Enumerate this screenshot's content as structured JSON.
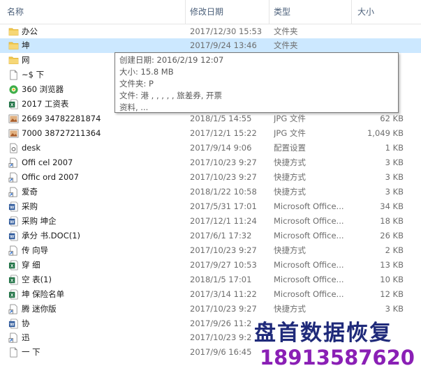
{
  "header": {
    "name_label": "名称",
    "date_label": "修改日期",
    "type_label": "类型",
    "size_label": "大小",
    "sort_arrow": "^"
  },
  "rows": [
    {
      "name": "办公",
      "date": "2017/12/30 15:53",
      "type": "文件夹",
      "size": "",
      "icon": "folder-icon"
    },
    {
      "name": "坤",
      "date": "2017/9/24 13:46",
      "type": "文件夹",
      "size": "",
      "icon": "folder-icon"
    },
    {
      "name": "网",
      "date": "",
      "type": "",
      "size": "",
      "icon": "folder-icon"
    },
    {
      "name": "~$   下",
      "date": "",
      "type": "",
      "size": "",
      "icon": "document-icon"
    },
    {
      "name": "360   浏览器",
      "date": "",
      "type": "",
      "size": "",
      "icon": "browser-icon"
    },
    {
      "name": "2017   工资表",
      "date": "",
      "type": "",
      "size": "",
      "icon": "excel-icon"
    },
    {
      "name": "2669   34782281874",
      "date": "2018/1/5 14:55",
      "type": "JPG 文件",
      "size": "62 KB",
      "icon": "image-icon"
    },
    {
      "name": "7000   38727211364",
      "date": "2017/12/1 15:22",
      "type": "JPG 文件",
      "size": "1,049 KB",
      "icon": "image-icon"
    },
    {
      "name": "desk",
      "date": "2017/9/14 9:06",
      "type": "配置设置",
      "size": "1 KB",
      "icon": "settings-file-icon"
    },
    {
      "name": "Offi   cel 2007",
      "date": "2017/10/23 9:27",
      "type": "快捷方式",
      "size": "3 KB",
      "icon": "shortcut-icon"
    },
    {
      "name": "Offic   ord 2007",
      "date": "2017/10/23 9:27",
      "type": "快捷方式",
      "size": "3 KB",
      "icon": "shortcut-icon"
    },
    {
      "name": "爱奇",
      "date": "2018/1/22 10:58",
      "type": "快捷方式",
      "size": "3 KB",
      "icon": "shortcut-icon"
    },
    {
      "name": "采购",
      "date": "2017/5/31 17:01",
      "type": "Microsoft Office...",
      "size": "34 KB",
      "icon": "word-icon"
    },
    {
      "name": "采购   坤企",
      "date": "2017/12/1 11:24",
      "type": "Microsoft Office...",
      "size": "18 KB",
      "icon": "word-icon"
    },
    {
      "name": "承分   书.DOC(1)",
      "date": "2017/6/1 17:32",
      "type": "Microsoft Office...",
      "size": "26 KB",
      "icon": "word-icon"
    },
    {
      "name": "传   向导",
      "date": "2017/10/23 9:27",
      "type": "快捷方式",
      "size": "2 KB",
      "icon": "shortcut-icon"
    },
    {
      "name": "穿   细",
      "date": "2017/9/27 10:53",
      "type": "Microsoft Office...",
      "size": "13 KB",
      "icon": "excel-icon"
    },
    {
      "name": "空   表(1)",
      "date": "2018/1/5 17:01",
      "type": "Microsoft Office...",
      "size": "10 KB",
      "icon": "excel-icon"
    },
    {
      "name": "坤   保险名单",
      "date": "2017/3/14 11:22",
      "type": "Microsoft Office...",
      "size": "12 KB",
      "icon": "excel-icon"
    },
    {
      "name": "腾   迷你版",
      "date": "2017/10/23 9:27",
      "type": "快捷方式",
      "size": "3 KB",
      "icon": "shortcut-icon"
    },
    {
      "name": "协",
      "date": "2017/9/26 11:2",
      "type": "",
      "size": "",
      "icon": "word-icon"
    },
    {
      "name": "迅",
      "date": "2017/10/23 9:2",
      "type": "",
      "size": "",
      "icon": "shortcut-icon"
    },
    {
      "name": "一   下",
      "date": "2017/9/6 16:45",
      "type": "",
      "size": "",
      "icon": "document-icon"
    }
  ],
  "tooltip": {
    "line1": "创建日期: 2016/2/19 12:07",
    "line2": "大小: 15.8 MB",
    "line3": "文件夹: P",
    "line4": "文件: 港   ,        ,   ,       ,     ,  旅差券, 开票",
    "line5": "资料, ..."
  },
  "watermark": {
    "title": "盘首数据恢复",
    "phone": "18913587620"
  },
  "colors": {
    "selected_row": "#cce8ff",
    "hover_row": "#e5f3ff",
    "folder": "#f0c64a",
    "header_text": "#4c607a",
    "watermark_title": "#1f2a7a",
    "watermark_phone": "#8a1fb5"
  }
}
